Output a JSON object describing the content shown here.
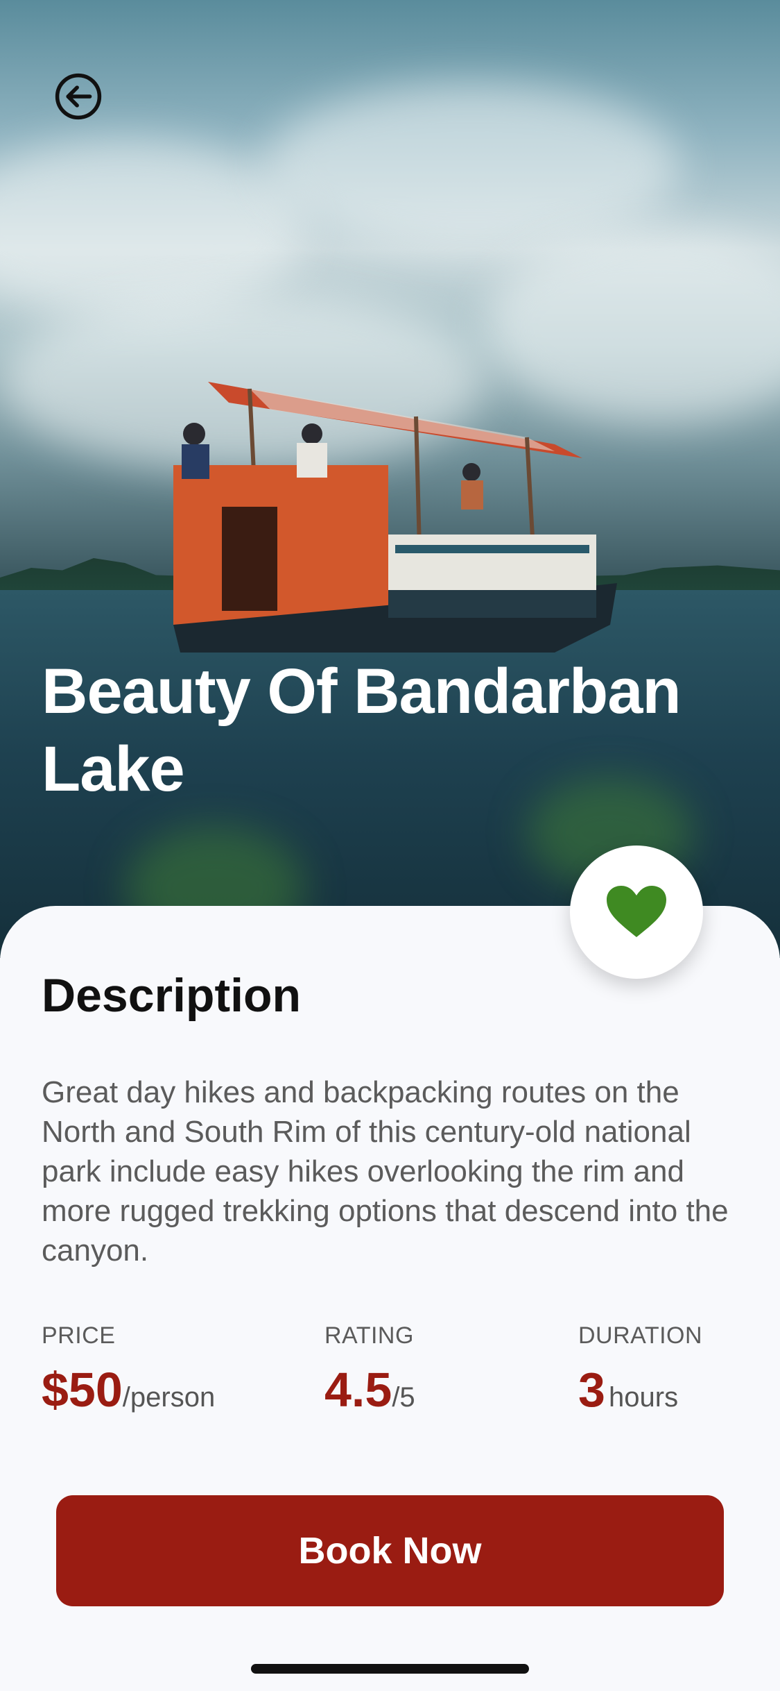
{
  "hero": {
    "title": "Beauty Of Bandarban Lake",
    "back_icon": "arrow-left-circle-icon"
  },
  "favorite": {
    "icon": "heart-icon",
    "color": "#3f8a22"
  },
  "description": {
    "heading": "Description",
    "text": "Great day hikes and backpacking routes on the North and South Rim of this century-old national park include easy hikes overlooking the rim and more rugged trekking options that descend into the canyon."
  },
  "stats": {
    "price": {
      "label": "PRICE",
      "value": "$50",
      "unit": "/person"
    },
    "rating": {
      "label": "RATING",
      "value": "4.5",
      "unit": "/5"
    },
    "duration": {
      "label": "DURATION",
      "value": "3",
      "unit": "hours"
    }
  },
  "cta": {
    "label": "Book Now"
  },
  "colors": {
    "accent": "#9a1c12",
    "heart": "#3f8a22"
  }
}
